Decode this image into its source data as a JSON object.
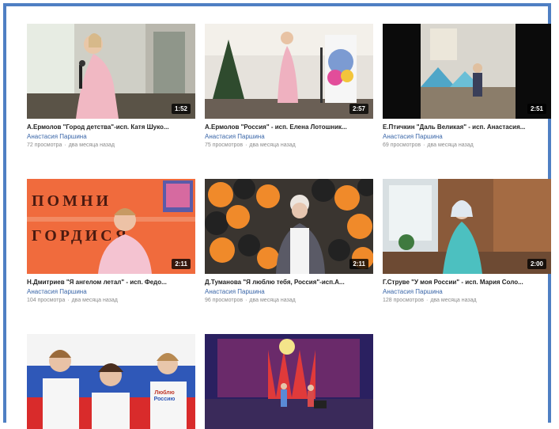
{
  "videos": [
    {
      "title": "А.Ермолов \"Город детства\"-исп. Катя Шуко...",
      "author": "Анастасия Паршина",
      "views": "72 просмотра",
      "age": "два месяца назад",
      "duration": "1:52"
    },
    {
      "title": "А.Ермолов \"Россия\" - исп. Елена Лотошник...",
      "author": "Анастасия Паршина",
      "views": "75 просмотров",
      "age": "два месяца назад",
      "duration": "2:57"
    },
    {
      "title": "Е.Птичкин \"Даль Великая\" - исп. Анастасия...",
      "author": "Анастасия Паршина",
      "views": "69 просмотров",
      "age": "два месяца назад",
      "duration": "2:51"
    },
    {
      "title": "Н.Дмитриев \"Я ангелом летал\" - исп. Федо...",
      "author": "Анастасия Паршина",
      "views": "104 просмотра",
      "age": "два месяца назад",
      "duration": "2:11"
    },
    {
      "title": "Д.Туманова \"Я люблю тебя, Россия\"-исп.А...",
      "author": "Анастасия Паршина",
      "views": "96 просмотров",
      "age": "два месяца назад",
      "duration": "2:11"
    },
    {
      "title": "Г.Струве \"У моя России\" - исп. Мария Соло...",
      "author": "Анастасия Паршина",
      "views": "128 просмотров",
      "age": "два месяца назад",
      "duration": "2:00"
    },
    {
      "title": "",
      "author": "",
      "views": "",
      "age": "",
      "duration": ""
    },
    {
      "title": "",
      "author": "",
      "views": "",
      "age": "",
      "duration": ""
    }
  ],
  "thumb_text": {
    "sign_line1": "ПОМНИ",
    "sign_line2": "ГОРДИСЯ.",
    "shirt1": "Люблю",
    "shirt2": "Россию"
  },
  "colors": {
    "frame": "#4f7fc3",
    "author_link": "#3a66a8"
  }
}
